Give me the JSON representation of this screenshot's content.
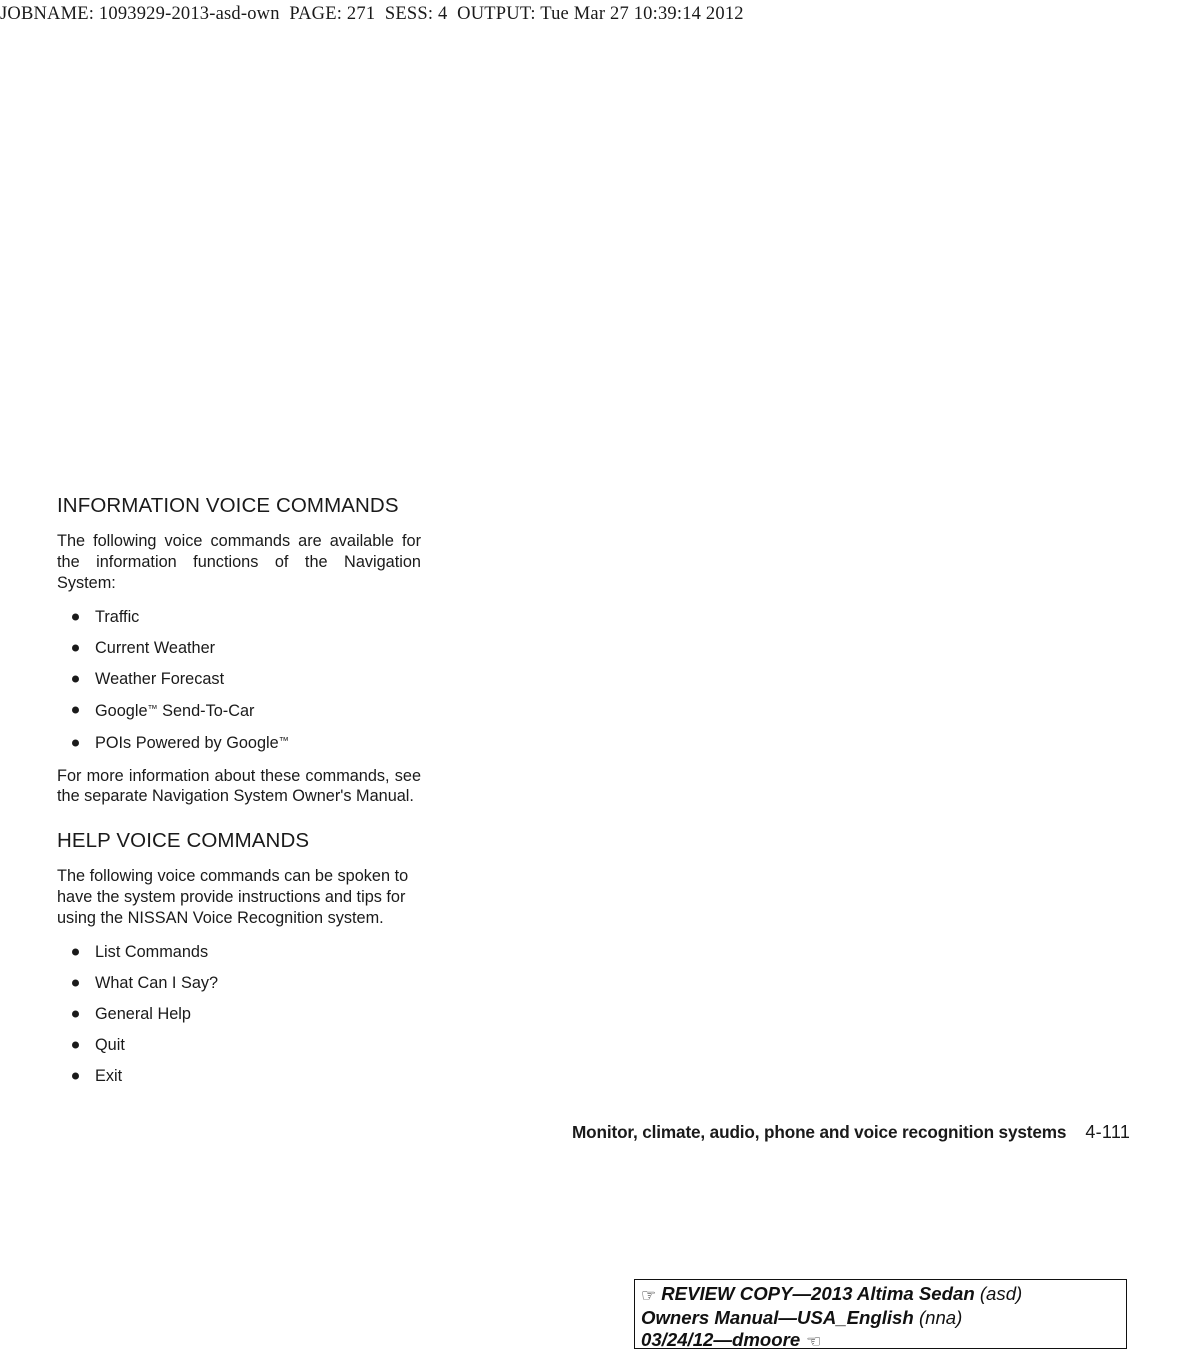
{
  "job_header": "JOBNAME: 1093929-2013-asd-own  PAGE: 271  SESS: 4  OUTPUT: Tue Mar 27 10:39:14 2012",
  "sections": [
    {
      "heading": "INFORMATION VOICE COMMANDS",
      "intro": "The following voice commands are available for the information functions of the Navigation System:",
      "bullets": [
        "Traffic",
        "Current Weather",
        "Weather Forecast",
        "Google™ Send-To-Car",
        "POIs Powered by Google™"
      ],
      "outro": "For more information about these commands, see the separate Navigation System Owner's Manual."
    },
    {
      "heading": "HELP VOICE COMMANDS",
      "intro": "The following voice commands can be spoken to have the system provide instructions and tips for using the NISSAN Voice Recognition system.",
      "bullets": [
        "List Commands",
        "What Can I Say?",
        "General Help",
        "Quit",
        "Exit"
      ]
    }
  ],
  "footer": {
    "section_title": "Monitor, climate, audio, phone and voice recognition systems",
    "page_number": "4-111"
  },
  "review_stamp": {
    "hand_right_icon": "☞",
    "hand_left_icon": "☜",
    "line1_bold": "REVIEW COPY—2013 Altima Sedan",
    "line1_paren": "(asd)",
    "line2_bold": "Owners Manual—USA_English",
    "line2_paren": "(nna)",
    "line3_bold": "03/24/12—dmoore"
  },
  "colors": {
    "text": "#1a1a1a",
    "stamp_border": "#111111",
    "page_background": "#ffffff"
  }
}
